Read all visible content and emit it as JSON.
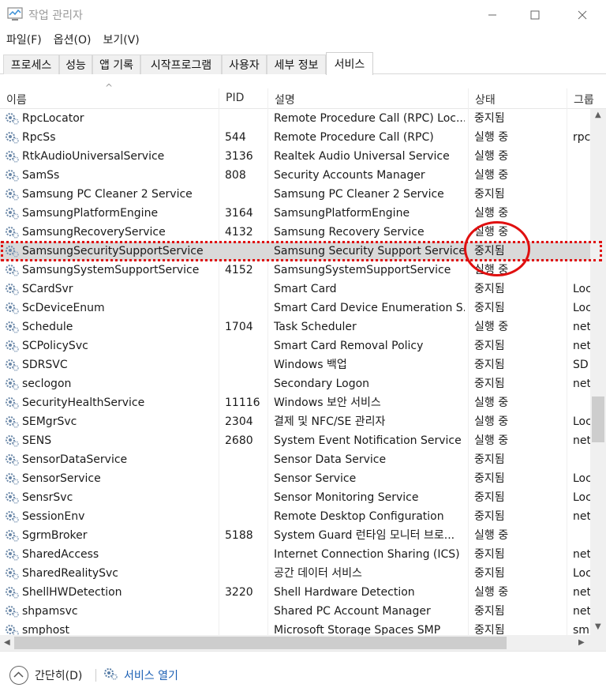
{
  "window": {
    "title": "작업 관리자"
  },
  "menu": [
    "파일(F)",
    "옵션(O)",
    "보기(V)"
  ],
  "tabs": [
    {
      "label": "프로세스",
      "active": false
    },
    {
      "label": "성능",
      "active": false
    },
    {
      "label": "앱 기록",
      "active": false
    },
    {
      "label": "시작프로그램",
      "active": false
    },
    {
      "label": "사용자",
      "active": false
    },
    {
      "label": "세부 정보",
      "active": false
    },
    {
      "label": "서비스",
      "active": true
    }
  ],
  "columns": {
    "name": "이름",
    "pid": "PID",
    "desc": "설명",
    "status": "상태",
    "group": "그룹"
  },
  "rows": [
    {
      "name": "RpcLocator",
      "pid": "",
      "desc": "Remote Procedure Call (RPC) Loc...",
      "status": "중지됨",
      "group": ""
    },
    {
      "name": "RpcSs",
      "pid": "544",
      "desc": "Remote Procedure Call (RPC)",
      "status": "실행 중",
      "group": "rpc"
    },
    {
      "name": "RtkAudioUniversalService",
      "pid": "3136",
      "desc": "Realtek Audio Universal Service",
      "status": "실행 중",
      "group": ""
    },
    {
      "name": "SamSs",
      "pid": "808",
      "desc": "Security Accounts Manager",
      "status": "실행 중",
      "group": ""
    },
    {
      "name": "Samsung PC Cleaner 2 Service",
      "pid": "",
      "desc": "Samsung PC Cleaner 2 Service",
      "status": "중지됨",
      "group": ""
    },
    {
      "name": "SamsungPlatformEngine",
      "pid": "3164",
      "desc": "SamsungPlatformEngine",
      "status": "실행 중",
      "group": ""
    },
    {
      "name": "SamsungRecoveryService",
      "pid": "4132",
      "desc": "Samsung Recovery Service",
      "status": "실행 중",
      "group": ""
    },
    {
      "name": "SamsungSecuritySupportService",
      "pid": "",
      "desc": "Samsung Security Support Service",
      "status": "중지됨",
      "group": "",
      "selected": true
    },
    {
      "name": "SamsungSystemSupportService",
      "pid": "4152",
      "desc": "SamsungSystemSupportService",
      "status": "실행 중",
      "group": ""
    },
    {
      "name": "SCardSvr",
      "pid": "",
      "desc": "Smart Card",
      "status": "중지됨",
      "group": "Loc"
    },
    {
      "name": "ScDeviceEnum",
      "pid": "",
      "desc": "Smart Card Device Enumeration S...",
      "status": "중지됨",
      "group": "Loc"
    },
    {
      "name": "Schedule",
      "pid": "1704",
      "desc": "Task Scheduler",
      "status": "실행 중",
      "group": "net"
    },
    {
      "name": "SCPolicySvc",
      "pid": "",
      "desc": "Smart Card Removal Policy",
      "status": "중지됨",
      "group": "net"
    },
    {
      "name": "SDRSVC",
      "pid": "",
      "desc": "Windows 백업",
      "status": "중지됨",
      "group": "SD"
    },
    {
      "name": "seclogon",
      "pid": "",
      "desc": "Secondary Logon",
      "status": "중지됨",
      "group": "net"
    },
    {
      "name": "SecurityHealthService",
      "pid": "11116",
      "desc": "Windows 보안 서비스",
      "status": "실행 중",
      "group": ""
    },
    {
      "name": "SEMgrSvc",
      "pid": "2304",
      "desc": "결제 및 NFC/SE 관리자",
      "status": "실행 중",
      "group": "Loc"
    },
    {
      "name": "SENS",
      "pid": "2680",
      "desc": "System Event Notification Service",
      "status": "실행 중",
      "group": "net"
    },
    {
      "name": "SensorDataService",
      "pid": "",
      "desc": "Sensor Data Service",
      "status": "중지됨",
      "group": ""
    },
    {
      "name": "SensorService",
      "pid": "",
      "desc": "Sensor Service",
      "status": "중지됨",
      "group": "Loc"
    },
    {
      "name": "SensrSvc",
      "pid": "",
      "desc": "Sensor Monitoring Service",
      "status": "중지됨",
      "group": "Loc"
    },
    {
      "name": "SessionEnv",
      "pid": "",
      "desc": "Remote Desktop Configuration",
      "status": "중지됨",
      "group": "net"
    },
    {
      "name": "SgrmBroker",
      "pid": "5188",
      "desc": "System Guard 런타임 모니터 브로...",
      "status": "실행 중",
      "group": ""
    },
    {
      "name": "SharedAccess",
      "pid": "",
      "desc": "Internet Connection Sharing (ICS)",
      "status": "중지됨",
      "group": "net"
    },
    {
      "name": "SharedRealitySvc",
      "pid": "",
      "desc": "공간 데이터 서비스",
      "status": "중지됨",
      "group": "Loc"
    },
    {
      "name": "ShellHWDetection",
      "pid": "3220",
      "desc": "Shell Hardware Detection",
      "status": "실행 중",
      "group": "net"
    },
    {
      "name": "shpamsvc",
      "pid": "",
      "desc": "Shared PC Account Manager",
      "status": "중지됨",
      "group": "net"
    },
    {
      "name": "smphost",
      "pid": "",
      "desc": "Microsoft Storage Spaces SMP",
      "status": "중지됨",
      "group": "sm"
    }
  ],
  "footer": {
    "collapse": "간단히(D)",
    "open_services": "서비스 열기"
  },
  "colors": {
    "annotation": "#e01010",
    "selected_row": "#d9d9d9",
    "link": "#1a5fb4"
  }
}
